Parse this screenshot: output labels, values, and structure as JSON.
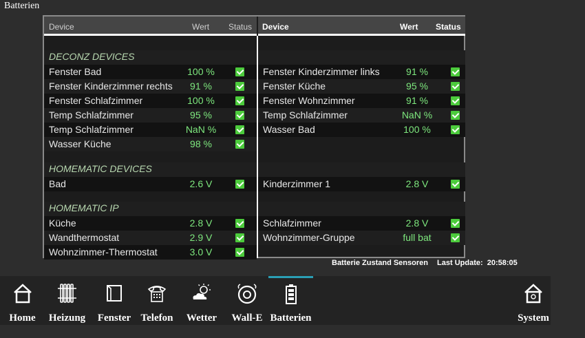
{
  "page": {
    "title": "Batterien"
  },
  "table": {
    "left_header": {
      "device": "Device",
      "wert": "Wert",
      "status": "Status"
    },
    "right_header": {
      "device": "Device",
      "wert": "Wert",
      "status": "Status"
    },
    "sections": {
      "deconz": "DECONZ DEVICES",
      "homematic": "HOMEMATIC DEVICES",
      "homematic_ip": "HOMEMATIC IP"
    },
    "left": {
      "deconz": [
        {
          "name": "Fenster Bad",
          "value": "100 %"
        },
        {
          "name": "Fenster Kinderzimmer rechts",
          "value": "91 %"
        },
        {
          "name": "Fenster Schlafzimmer",
          "value": "100 %"
        },
        {
          "name": "Temp Schlafzimmer",
          "value": "95 %"
        },
        {
          "name": "Temp Schlafzimmer",
          "value": "NaN %"
        },
        {
          "name": "Wasser Küche",
          "value": "98 %"
        }
      ],
      "homematic": [
        {
          "name": "Bad",
          "value": "2.6 V"
        }
      ],
      "homematic_ip": [
        {
          "name": "Küche",
          "value": "2.8 V"
        },
        {
          "name": "Wandthermostat",
          "value": "2.9 V"
        },
        {
          "name": "Wohnzimmer-Thermostat",
          "value": "3.0 V"
        }
      ]
    },
    "right": {
      "deconz": [
        {
          "name": "Fenster Kinderzimmer links",
          "value": "91 %"
        },
        {
          "name": "Fenster Küche",
          "value": "95 %"
        },
        {
          "name": "Fenster Wohnzimmer",
          "value": "91 %"
        },
        {
          "name": "Temp Schlafzimmer",
          "value": "NaN %"
        },
        {
          "name": "Wasser Bad",
          "value": "100 %"
        }
      ],
      "homematic": [
        {
          "name": "Kinderzimmer 1",
          "value": "2.8 V"
        }
      ],
      "homematic_ip": [
        {
          "name": "Schlafzimmer",
          "value": "2.8 V"
        },
        {
          "name": "Wohnzimmer-Gruppe",
          "value": "full bat"
        }
      ]
    }
  },
  "footer": {
    "label": "Batterie Zustand Sensoren",
    "last_update_label": "Last Update:",
    "last_update_time": "20:58:05"
  },
  "nav": [
    {
      "label": "Home",
      "icon": "home-icon"
    },
    {
      "label": "Heizung",
      "icon": "radiator-icon"
    },
    {
      "label": "Fenster",
      "icon": "window-icon"
    },
    {
      "label": "Telefon",
      "icon": "phone-icon"
    },
    {
      "label": "Wetter",
      "icon": "weather-icon"
    },
    {
      "label": "Wall-E",
      "icon": "robot-vacuum-icon"
    },
    {
      "label": "Batterien",
      "icon": "battery-icon"
    },
    {
      "label": "System",
      "icon": "house-settings-icon"
    }
  ],
  "colors": {
    "accent": "#2a9fb5",
    "value_green": "#7ee87e",
    "check_green": "#4ccb3c"
  }
}
